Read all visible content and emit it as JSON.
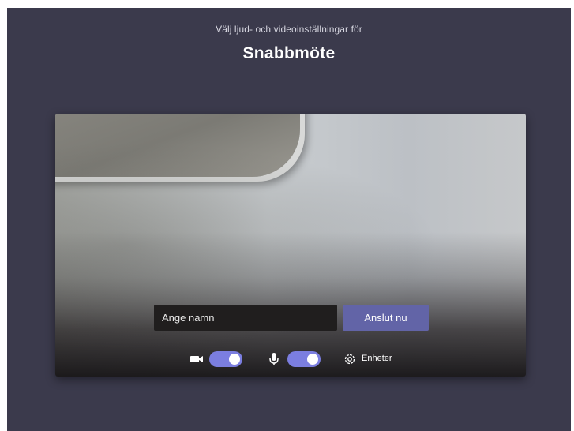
{
  "header": {
    "subtitle": "Välj ljud- och videoinställningar för",
    "meeting_title": "Snabbmöte"
  },
  "join_form": {
    "name_placeholder": "Ange namn",
    "name_value": "",
    "join_label": "Anslut nu"
  },
  "controls": {
    "camera": {
      "icon": "video-camera-icon",
      "enabled": true
    },
    "microphone": {
      "icon": "microphone-icon",
      "enabled": true
    },
    "devices": {
      "icon": "gear-icon",
      "label": "Enheter"
    }
  },
  "colors": {
    "background": "#3b3a4c",
    "accent": "#6264a7",
    "toggle_on": "#7b7ee0"
  }
}
